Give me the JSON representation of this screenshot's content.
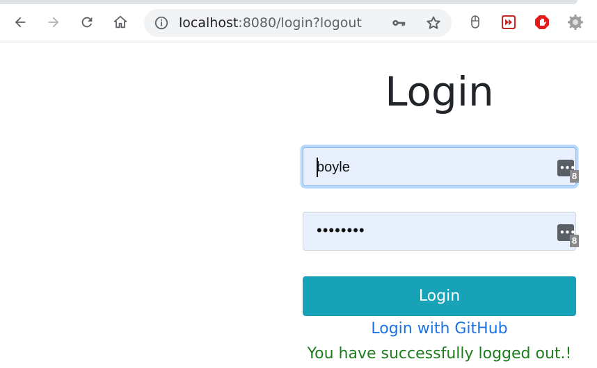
{
  "browser": {
    "url_host": "localhost",
    "url_rest": ":8080/login?logout",
    "icons": [
      "back-icon",
      "forward-icon",
      "reload-icon",
      "home-icon",
      "info-icon",
      "key-icon",
      "star-icon",
      "mouse-extension-icon",
      "video-extension-icon",
      "stop-extension-icon",
      "settings-extension-icon"
    ]
  },
  "page": {
    "title": "Login",
    "username_value": "boyle",
    "password_value": "••••••••",
    "password_manager_badge": "8",
    "login_button": "Login",
    "github_link": "Login with GitHub",
    "logout_message": "You have successfully logged out.!"
  },
  "colors": {
    "button": "#17a2b8",
    "link": "#1a73e8",
    "success": "#1e7e1e",
    "field_bg": "#e8f0fe"
  }
}
